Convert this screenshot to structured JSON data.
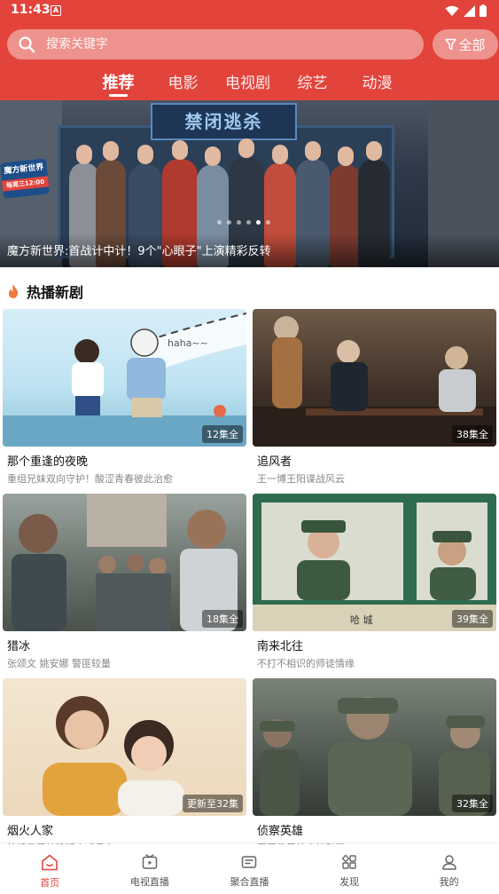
{
  "status_bar": {
    "time": "11:43",
    "notification": "A"
  },
  "search": {
    "placeholder": "搜索关键字",
    "filter_label": "全部"
  },
  "tabs": [
    {
      "label": "推荐",
      "active": true
    },
    {
      "label": "电影",
      "active": false
    },
    {
      "label": "电视剧",
      "active": false
    },
    {
      "label": "综艺",
      "active": false
    },
    {
      "label": "动漫",
      "active": false
    }
  ],
  "banner": {
    "caption": "魔方新世界:首战计中计！9个\"心眼子\"上演精彩反转",
    "sign_text": "禁闭逃杀",
    "logo_text": "魔方新世界",
    "logo_sub": "每周三12:00",
    "dots_count": 6,
    "active_dot": 4
  },
  "section": {
    "title": "热播新剧",
    "icon": "fire-icon"
  },
  "shows": [
    {
      "title": "那个重逢的夜晚",
      "desc": "重组兄妹双向守护！酸涩青春彼此治愈",
      "badge": "12集全",
      "theme": "sky"
    },
    {
      "title": "追风者",
      "desc": "王一博王阳谍战风云",
      "badge": "38集全",
      "theme": "sepia"
    },
    {
      "title": "猎冰",
      "desc": "张颂文 姚安娜 警匪较量",
      "badge": "18集全",
      "theme": "street"
    },
    {
      "title": "南来北往",
      "desc": "不打不相识的师徒情缘",
      "badge": "39集全",
      "theme": "train"
    },
    {
      "title": "烟火人家",
      "desc": "徐帆马思纯演活中式母女",
      "badge": "更新至32集",
      "theme": "warm"
    },
    {
      "title": "侦察英雄",
      "desc": "罗晋马思纯守护和平",
      "badge": "32集全",
      "theme": "war"
    }
  ],
  "bottom_nav": [
    {
      "label": "首页",
      "icon": "home-icon",
      "active": true
    },
    {
      "label": "电视直播",
      "icon": "tv-icon",
      "active": false
    },
    {
      "label": "聚合直播",
      "icon": "live-icon",
      "active": false
    },
    {
      "label": "发现",
      "icon": "discover-icon",
      "active": false
    },
    {
      "label": "我的",
      "icon": "profile-icon",
      "active": false
    }
  ],
  "colors": {
    "accent": "#e2443c"
  }
}
